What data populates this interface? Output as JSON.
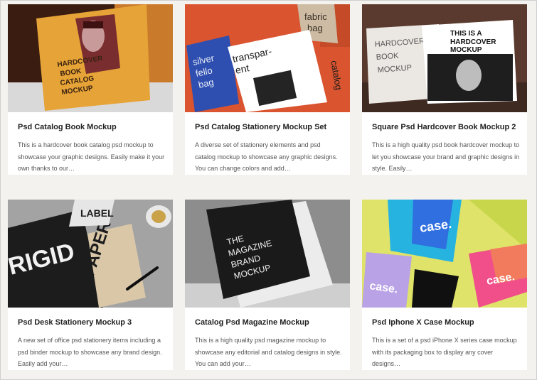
{
  "cards": [
    {
      "title": "Psd Catalog Book Mockup",
      "description": "This is a hardcover book catalog psd mockup to showcase your graphic designs. Easily make it your own thanks to our…",
      "image_lines": [
        "HARDCOVER",
        "BOOK",
        "CATALOG",
        "MOCKUP"
      ]
    },
    {
      "title": "Psd Catalog Stationery Mockup Set",
      "description": "A diverse set of stationery elements and psd catalog mockup to showcase any graphic designs. You can change colors and add…",
      "image_lines": [
        "silver",
        "fello",
        "bag",
        "transpar-",
        "ent",
        "catalog",
        "fabric",
        "bag",
        "catalog"
      ]
    },
    {
      "title": "Square Psd Hardcover Book Mockup 2",
      "description": "This is a high quality psd book hardcover mockup to let you showcase your brand and graphic designs in style. Easily…",
      "image_lines": [
        "THIS IS A",
        "HARDCOVER",
        "BOOK",
        "MOCKUP"
      ]
    },
    {
      "title": "Psd Desk Stationery Mockup 3",
      "description": "A new set of office psd stationery items including a psd binder mockup to showcase any brand design. Easily add your…",
      "image_lines": [
        "RIGID",
        "PAPER",
        "LABEL"
      ]
    },
    {
      "title": "Catalog Psd Magazine Mockup",
      "description": "This is a high quality psd magazine mockup to showcase any editorial and catalog designs in style. You can add your…",
      "image_lines": [
        "THE",
        "MAGAZINE",
        "BRAND",
        "MOCKUP"
      ]
    },
    {
      "title": "Psd Iphone X Case Mockup",
      "description": "This is a set of a psd iPhone X series case mockup with its packaging box to display any cover designs…",
      "image_lines": [
        "case.",
        "case.",
        "case."
      ]
    }
  ]
}
